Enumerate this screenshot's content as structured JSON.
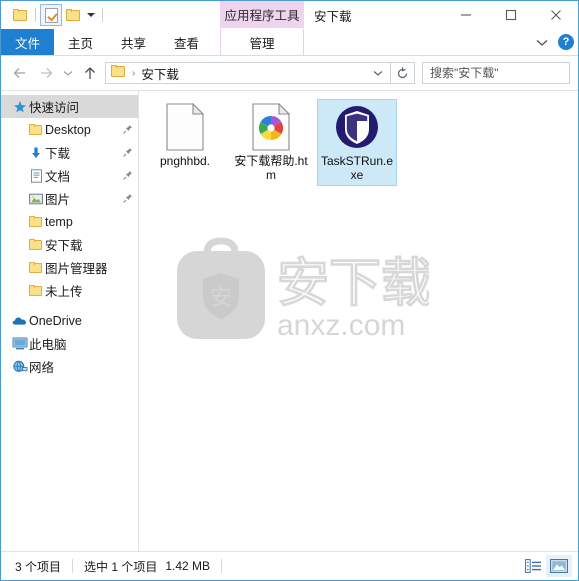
{
  "window": {
    "title": "安下载",
    "contextual_tab_group": "应用程序工具",
    "controls": {
      "minimize": "minimize-icon",
      "maximize": "maximize-icon",
      "close": "close-icon"
    }
  },
  "quick_access_toolbar": {
    "items": [
      {
        "name": "folder-icon",
        "label": ""
      },
      {
        "name": "properties-icon",
        "label": ""
      },
      {
        "name": "new-folder-icon",
        "label": ""
      },
      {
        "name": "chevron-down-icon",
        "label": ""
      }
    ]
  },
  "ribbon": {
    "tabs": [
      {
        "label": "文件",
        "active": true
      },
      {
        "label": "主页",
        "active": false
      },
      {
        "label": "共享",
        "active": false
      },
      {
        "label": "查看",
        "active": false
      }
    ],
    "contextual_tab": {
      "label": "管理"
    },
    "collapse_icon": "chevron-up-icon",
    "help_label": "?"
  },
  "addressbar": {
    "back_icon": "arrow-left-icon",
    "forward_icon": "arrow-right-icon",
    "recent_icon": "chevron-down-icon",
    "up_icon": "arrow-up-icon",
    "breadcrumb": {
      "folder_icon": "folder-icon",
      "separator": "›",
      "path": "安下载"
    },
    "dropdown_icon": "chevron-down-icon",
    "refresh_icon": "refresh-icon",
    "search": {
      "placeholder": "搜索\"安下载\"",
      "value": "",
      "icon": "search-icon"
    }
  },
  "sidebar": {
    "items": [
      {
        "label": "快速访问",
        "icon": "star-icon",
        "level": 0,
        "selected": true,
        "pinned": false
      },
      {
        "label": "Desktop",
        "icon": "folder-icon",
        "level": 1,
        "selected": false,
        "pinned": true
      },
      {
        "label": "下载",
        "icon": "download-icon",
        "level": 1,
        "selected": false,
        "pinned": true
      },
      {
        "label": "文档",
        "icon": "document-icon",
        "level": 1,
        "selected": false,
        "pinned": true
      },
      {
        "label": "图片",
        "icon": "pictures-icon",
        "level": 1,
        "selected": false,
        "pinned": true
      },
      {
        "label": "temp",
        "icon": "folder-icon",
        "level": 1,
        "selected": false,
        "pinned": false
      },
      {
        "label": "安下载",
        "icon": "folder-icon",
        "level": 1,
        "selected": false,
        "pinned": false
      },
      {
        "label": "图片管理器",
        "icon": "folder-icon",
        "level": 1,
        "selected": false,
        "pinned": false
      },
      {
        "label": "未上传",
        "icon": "folder-icon",
        "level": 1,
        "selected": false,
        "pinned": false
      },
      {
        "label": "OneDrive",
        "icon": "cloud-icon",
        "level": 0,
        "selected": false,
        "pinned": false
      },
      {
        "label": "此电脑",
        "icon": "computer-icon",
        "level": 0,
        "selected": false,
        "pinned": false
      },
      {
        "label": "网络",
        "icon": "network-icon",
        "level": 0,
        "selected": false,
        "pinned": false
      }
    ]
  },
  "files": [
    {
      "name": "pnghhbd.",
      "icon": "blank-document-icon",
      "selected": false
    },
    {
      "name": "安下载帮助.htm",
      "icon": "html-document-icon",
      "selected": false
    },
    {
      "name": "TaskSTRun.exe",
      "icon": "shield-application-icon",
      "selected": true
    }
  ],
  "watermark": {
    "shield_text": "安",
    "brand_text": "安下载",
    "domain_text": "anxz.com"
  },
  "statusbar": {
    "item_count": "3 个项目",
    "selection": "选中 1 个项目",
    "size": "1.42 MB",
    "views": [
      {
        "name": "details-view-button",
        "active": false
      },
      {
        "name": "large-icons-view-button",
        "active": true
      }
    ]
  },
  "colors": {
    "accent": "#1f7fd0",
    "contextual_tab": "#efd4ef",
    "selection": "#cde8f7",
    "folder": "#fbe08a",
    "window_border": "#4a9bd1"
  }
}
